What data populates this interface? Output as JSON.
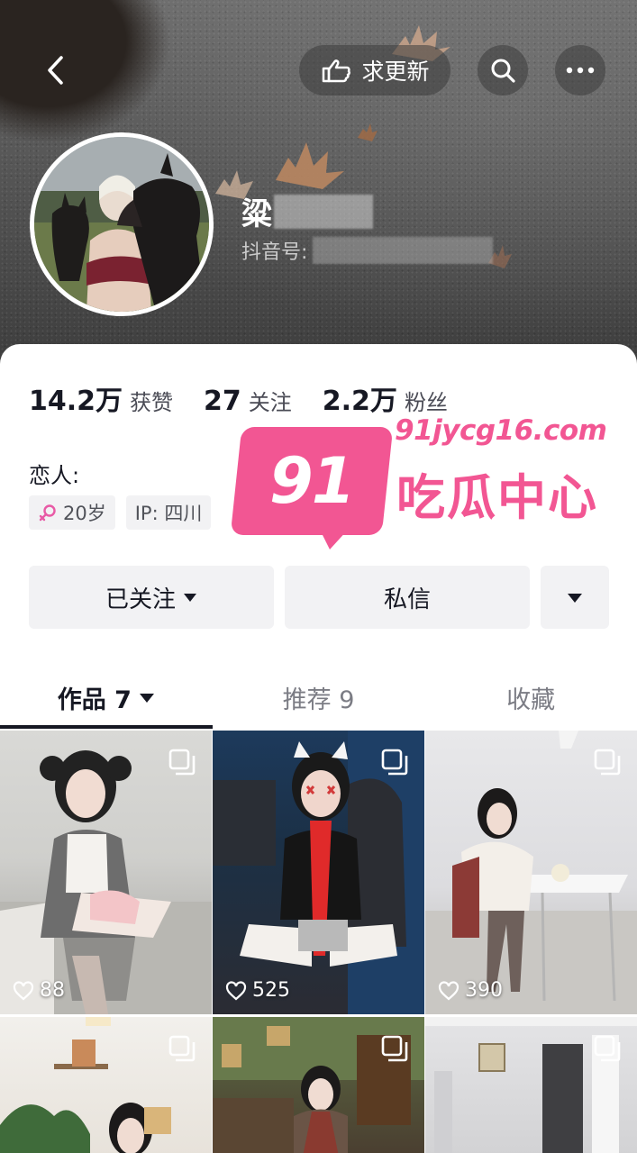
{
  "header": {
    "update_label": "求更新",
    "nickname_visible": "粱",
    "douyin_id_label": "抖音号:"
  },
  "stats": [
    {
      "value": "14.2万",
      "label": "获赞"
    },
    {
      "value": "27",
      "label": "关注"
    },
    {
      "value": "2.2万",
      "label": "粉丝"
    }
  ],
  "bio": "恋人:",
  "tags": {
    "age": "20岁",
    "ip": "IP:  四川"
  },
  "watermark": {
    "badge": "91",
    "domain": "91jycg16.com",
    "name": "吃瓜中心",
    "color": "#f25693"
  },
  "actions": {
    "follow_label": "已关注",
    "message_label": "私信"
  },
  "tabs": [
    {
      "label": "作品 7",
      "active": true
    },
    {
      "label": "推荐 9",
      "active": false
    },
    {
      "label": "收藏",
      "active": false
    }
  ],
  "videos": [
    {
      "likes": "88"
    },
    {
      "likes": "525"
    },
    {
      "likes": "390"
    }
  ]
}
